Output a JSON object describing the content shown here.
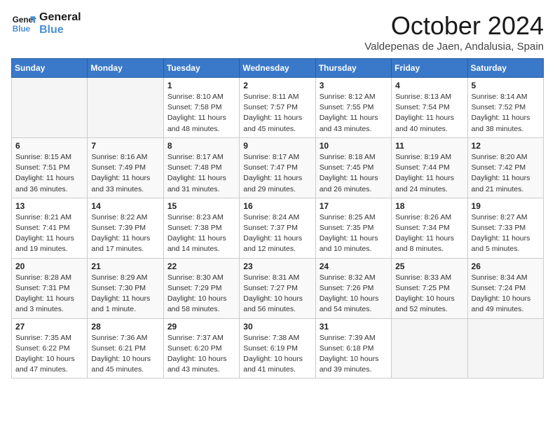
{
  "header": {
    "logo_line1": "General",
    "logo_line2": "Blue",
    "month_title": "October 2024",
    "location": "Valdepenas de Jaen, Andalusia, Spain"
  },
  "days_of_week": [
    "Sunday",
    "Monday",
    "Tuesday",
    "Wednesday",
    "Thursday",
    "Friday",
    "Saturday"
  ],
  "weeks": [
    [
      {
        "day": "",
        "info": ""
      },
      {
        "day": "",
        "info": ""
      },
      {
        "day": "1",
        "info": "Sunrise: 8:10 AM\nSunset: 7:58 PM\nDaylight: 11 hours and 48 minutes."
      },
      {
        "day": "2",
        "info": "Sunrise: 8:11 AM\nSunset: 7:57 PM\nDaylight: 11 hours and 45 minutes."
      },
      {
        "day": "3",
        "info": "Sunrise: 8:12 AM\nSunset: 7:55 PM\nDaylight: 11 hours and 43 minutes."
      },
      {
        "day": "4",
        "info": "Sunrise: 8:13 AM\nSunset: 7:54 PM\nDaylight: 11 hours and 40 minutes."
      },
      {
        "day": "5",
        "info": "Sunrise: 8:14 AM\nSunset: 7:52 PM\nDaylight: 11 hours and 38 minutes."
      }
    ],
    [
      {
        "day": "6",
        "info": "Sunrise: 8:15 AM\nSunset: 7:51 PM\nDaylight: 11 hours and 36 minutes."
      },
      {
        "day": "7",
        "info": "Sunrise: 8:16 AM\nSunset: 7:49 PM\nDaylight: 11 hours and 33 minutes."
      },
      {
        "day": "8",
        "info": "Sunrise: 8:17 AM\nSunset: 7:48 PM\nDaylight: 11 hours and 31 minutes."
      },
      {
        "day": "9",
        "info": "Sunrise: 8:17 AM\nSunset: 7:47 PM\nDaylight: 11 hours and 29 minutes."
      },
      {
        "day": "10",
        "info": "Sunrise: 8:18 AM\nSunset: 7:45 PM\nDaylight: 11 hours and 26 minutes."
      },
      {
        "day": "11",
        "info": "Sunrise: 8:19 AM\nSunset: 7:44 PM\nDaylight: 11 hours and 24 minutes."
      },
      {
        "day": "12",
        "info": "Sunrise: 8:20 AM\nSunset: 7:42 PM\nDaylight: 11 hours and 21 minutes."
      }
    ],
    [
      {
        "day": "13",
        "info": "Sunrise: 8:21 AM\nSunset: 7:41 PM\nDaylight: 11 hours and 19 minutes."
      },
      {
        "day": "14",
        "info": "Sunrise: 8:22 AM\nSunset: 7:39 PM\nDaylight: 11 hours and 17 minutes."
      },
      {
        "day": "15",
        "info": "Sunrise: 8:23 AM\nSunset: 7:38 PM\nDaylight: 11 hours and 14 minutes."
      },
      {
        "day": "16",
        "info": "Sunrise: 8:24 AM\nSunset: 7:37 PM\nDaylight: 11 hours and 12 minutes."
      },
      {
        "day": "17",
        "info": "Sunrise: 8:25 AM\nSunset: 7:35 PM\nDaylight: 11 hours and 10 minutes."
      },
      {
        "day": "18",
        "info": "Sunrise: 8:26 AM\nSunset: 7:34 PM\nDaylight: 11 hours and 8 minutes."
      },
      {
        "day": "19",
        "info": "Sunrise: 8:27 AM\nSunset: 7:33 PM\nDaylight: 11 hours and 5 minutes."
      }
    ],
    [
      {
        "day": "20",
        "info": "Sunrise: 8:28 AM\nSunset: 7:31 PM\nDaylight: 11 hours and 3 minutes."
      },
      {
        "day": "21",
        "info": "Sunrise: 8:29 AM\nSunset: 7:30 PM\nDaylight: 11 hours and 1 minute."
      },
      {
        "day": "22",
        "info": "Sunrise: 8:30 AM\nSunset: 7:29 PM\nDaylight: 10 hours and 58 minutes."
      },
      {
        "day": "23",
        "info": "Sunrise: 8:31 AM\nSunset: 7:27 PM\nDaylight: 10 hours and 56 minutes."
      },
      {
        "day": "24",
        "info": "Sunrise: 8:32 AM\nSunset: 7:26 PM\nDaylight: 10 hours and 54 minutes."
      },
      {
        "day": "25",
        "info": "Sunrise: 8:33 AM\nSunset: 7:25 PM\nDaylight: 10 hours and 52 minutes."
      },
      {
        "day": "26",
        "info": "Sunrise: 8:34 AM\nSunset: 7:24 PM\nDaylight: 10 hours and 49 minutes."
      }
    ],
    [
      {
        "day": "27",
        "info": "Sunrise: 7:35 AM\nSunset: 6:22 PM\nDaylight: 10 hours and 47 minutes."
      },
      {
        "day": "28",
        "info": "Sunrise: 7:36 AM\nSunset: 6:21 PM\nDaylight: 10 hours and 45 minutes."
      },
      {
        "day": "29",
        "info": "Sunrise: 7:37 AM\nSunset: 6:20 PM\nDaylight: 10 hours and 43 minutes."
      },
      {
        "day": "30",
        "info": "Sunrise: 7:38 AM\nSunset: 6:19 PM\nDaylight: 10 hours and 41 minutes."
      },
      {
        "day": "31",
        "info": "Sunrise: 7:39 AM\nSunset: 6:18 PM\nDaylight: 10 hours and 39 minutes."
      },
      {
        "day": "",
        "info": ""
      },
      {
        "day": "",
        "info": ""
      }
    ]
  ]
}
